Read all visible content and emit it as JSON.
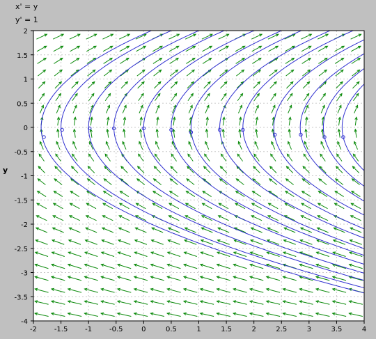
{
  "equations": {
    "x_prime": "x' = y",
    "y_prime": "y' = 1"
  },
  "colors": {
    "window_bg": "#c0c0c0",
    "plot_bg": "#ffffff",
    "arrow": "#0b8a0b",
    "curve": "#2f2fd0",
    "grid": "#c8c8c8"
  },
  "chart_data": {
    "type": "line",
    "title": "",
    "subtitle": "",
    "xlabel": "",
    "ylabel": "y",
    "xlim": [
      -2,
      4
    ],
    "ylim": [
      -4,
      2
    ],
    "grid": true,
    "x_ticks": [
      "-2",
      "-1.5",
      "-1",
      "-0.5",
      "0",
      "0.5",
      "1",
      "1.5",
      "2",
      "2.5",
      "3",
      "3.5",
      "4"
    ],
    "y_ticks": [
      "2",
      "1.5",
      "1",
      "0.5",
      "0",
      "-0.5",
      "-1",
      "-1.5",
      "-2",
      "-2.5",
      "-3",
      "-3.5",
      "-4"
    ],
    "direction_field": {
      "equations": [
        "x' = y",
        "y' = 1"
      ],
      "x_step": 0.3,
      "y_step": 0.25
    },
    "solution_curves": [
      {
        "vertex_x": -1.86,
        "marker": [
          -1.81,
          -0.2
        ]
      },
      {
        "vertex_x": -1.5,
        "marker": [
          -1.48,
          -0.05
        ]
      },
      {
        "vertex_x": -1.0,
        "marker": [
          -0.98,
          -0.02
        ]
      },
      {
        "vertex_x": -0.54,
        "marker": [
          -0.54,
          -0.02
        ]
      },
      {
        "vertex_x": 0.0,
        "marker": [
          0.0,
          -0.02
        ]
      },
      {
        "vertex_x": 0.5,
        "marker": [
          0.5,
          -0.05
        ]
      },
      {
        "vertex_x": 0.86,
        "marker": [
          0.86,
          -0.1
        ]
      },
      {
        "vertex_x": 1.38,
        "marker": [
          1.38,
          -0.05
        ]
      },
      {
        "vertex_x": 1.8,
        "marker": [
          1.8,
          -0.05
        ]
      },
      {
        "vertex_x": 2.36,
        "marker": [
          2.38,
          -0.15
        ]
      },
      {
        "vertex_x": 2.84,
        "marker": [
          2.85,
          -0.15
        ]
      },
      {
        "vertex_x": 3.26,
        "marker": [
          3.28,
          -0.2
        ]
      },
      {
        "vertex_x": 3.6,
        "marker": [
          3.62,
          -0.2
        ]
      }
    ]
  }
}
